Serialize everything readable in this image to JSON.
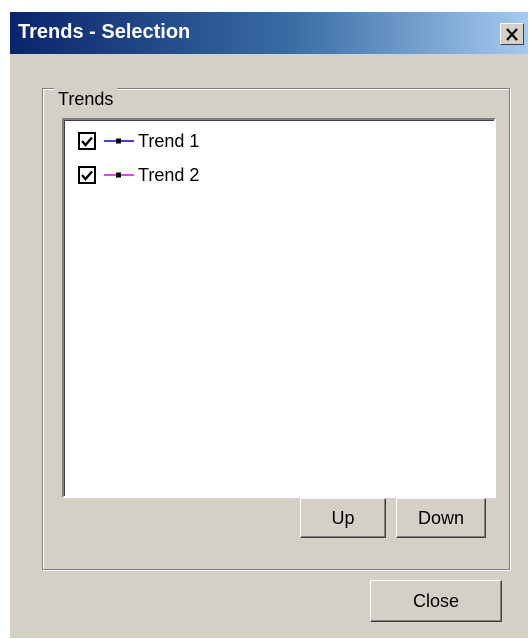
{
  "window": {
    "title": "Trends - Selection",
    "close_icon": "close-x-icon"
  },
  "group": {
    "label": "Trends"
  },
  "trends": [
    {
      "label": "Trend 1",
      "checked": true,
      "color": "#0000cc"
    },
    {
      "label": "Trend 2",
      "checked": true,
      "color": "#e000e0"
    }
  ],
  "buttons": {
    "up": "Up",
    "down": "Down",
    "close": "Close"
  }
}
